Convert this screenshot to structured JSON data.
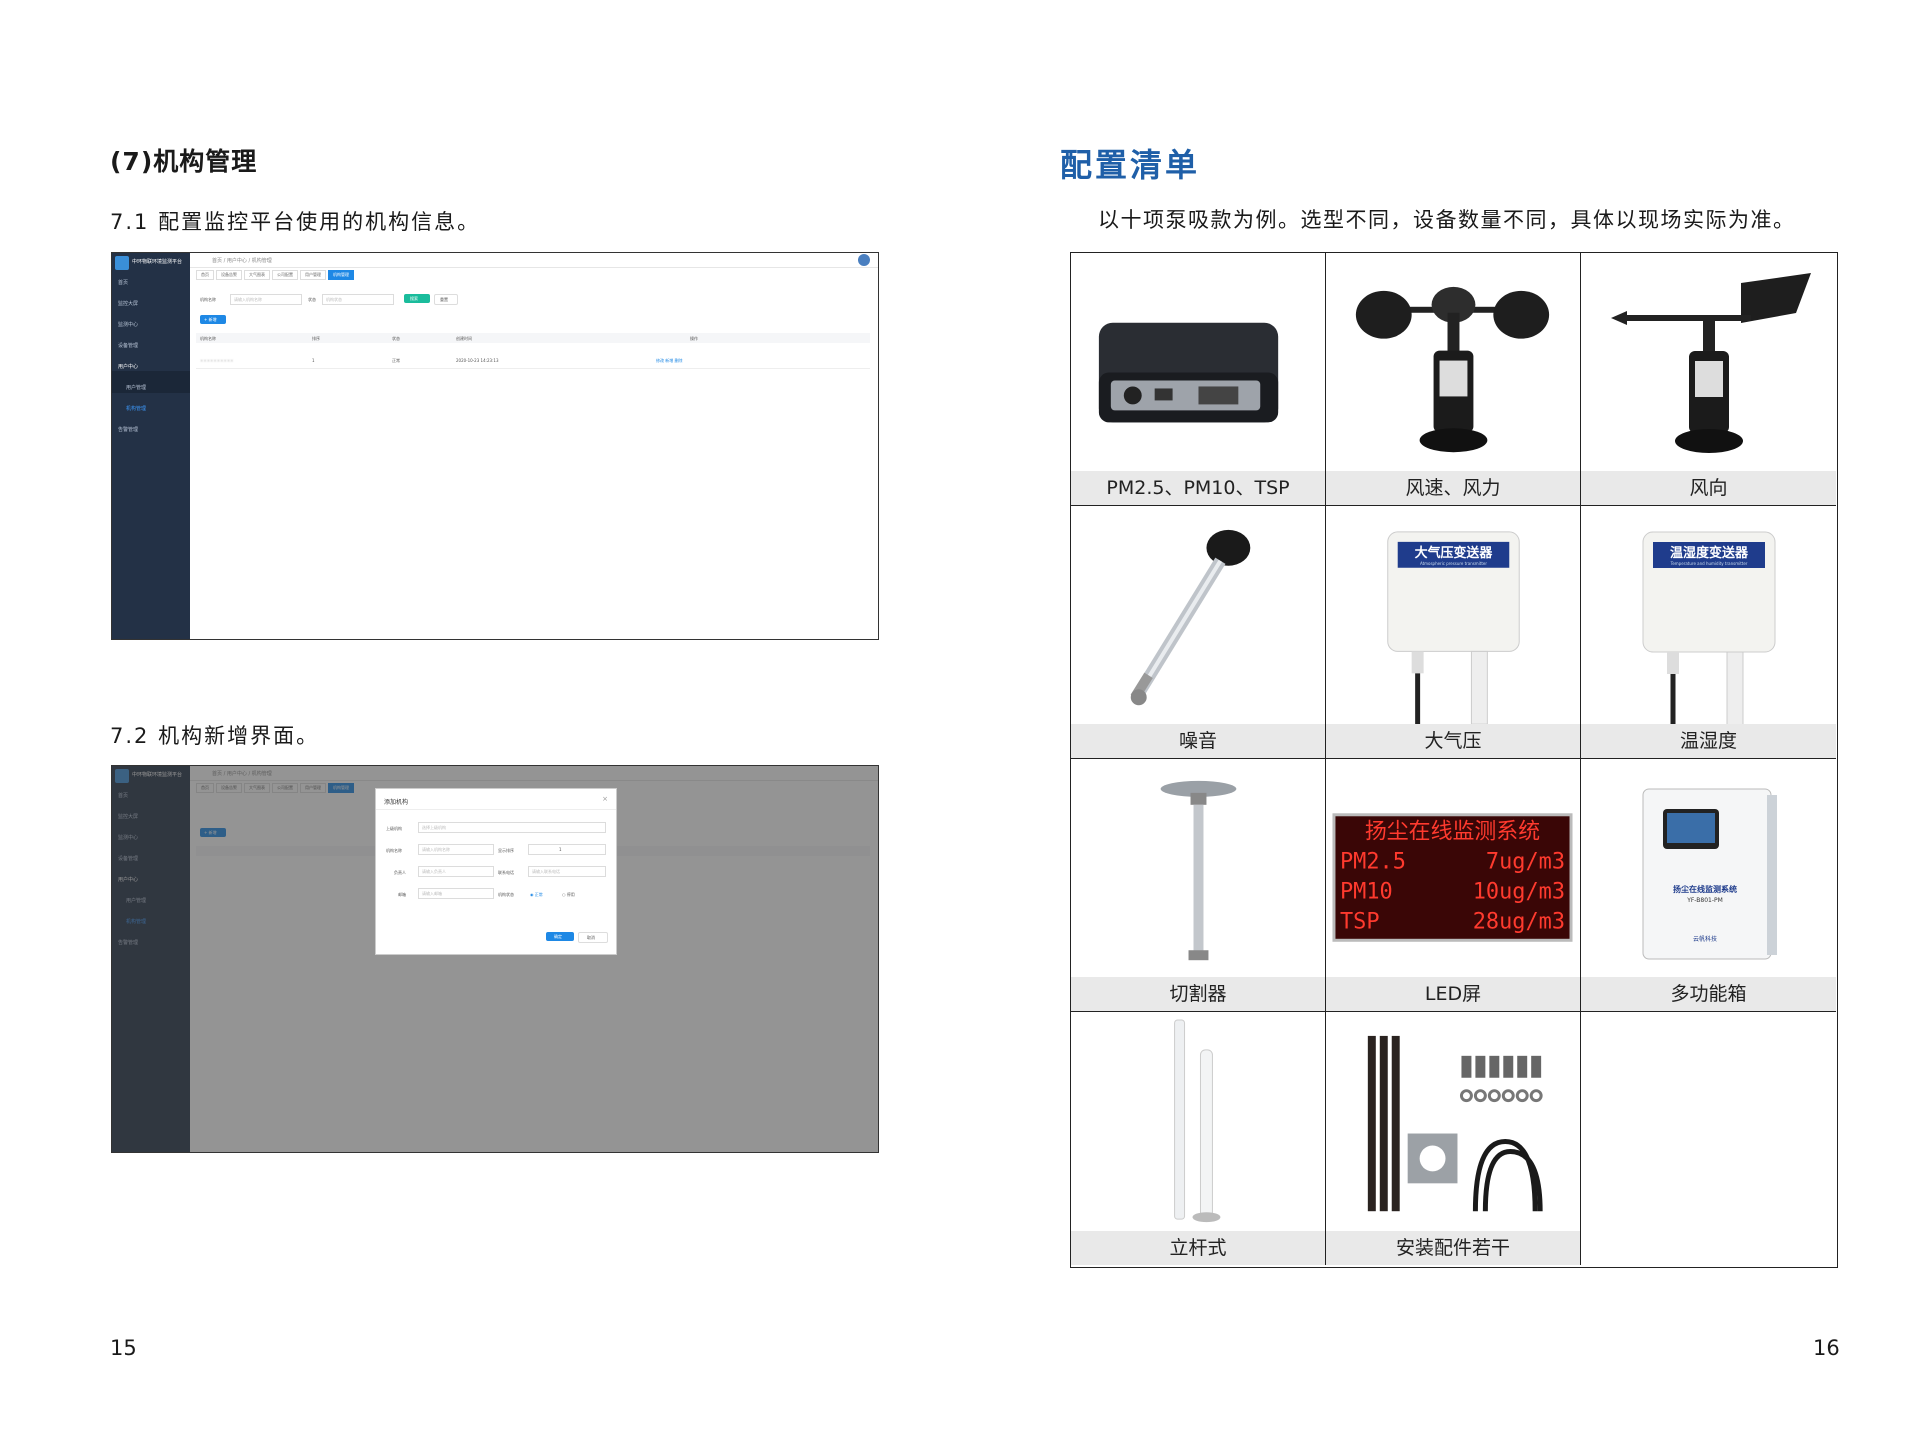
{
  "left_page": {
    "heading": "(7)机构管理",
    "item1": "7.1 配置监控平台使用的机构信息。",
    "item2": "7.2 机构新增界面。",
    "page_number": "15"
  },
  "right_page": {
    "heading": "配置清单",
    "note": "以十项泵吸款为例。选型不同，设备数量不同，具体以现场实际为准。",
    "page_number": "16"
  },
  "screenshot1": {
    "menu": [
      "首页",
      "监控大屏",
      "监测中心",
      "设备管理",
      "用户中心",
      "用户管理",
      "机构管理",
      "告警管理"
    ],
    "breadcrumb": "首页 / 用户中心 / 机构管理",
    "tabs": [
      "首页",
      "设备告警",
      "大气图表",
      "公司配置",
      "用户管理",
      "机构管理"
    ],
    "filter_name_label": "机构名称",
    "filter_name_placeholder": "请输入机构名称",
    "filter_status_label": "状态",
    "filter_status_placeholder": "机构状态",
    "search_btn": "搜索",
    "reset_btn": "重置",
    "add_btn": "+ 新增",
    "columns": [
      "机构名称",
      "排序",
      "状态",
      "创建时间",
      "操作"
    ],
    "rows": [
      [
        "××××××××××",
        "1",
        "正常",
        "2020-10-23 14:23:13",
        "修改  新增  删除"
      ]
    ]
  },
  "screenshot2": {
    "modal_title": "添加机构",
    "fields": [
      "上级机构",
      "机构名称",
      "显示排序",
      "负责人",
      "联系电话",
      "邮箱",
      "机构状态"
    ],
    "placeholders": [
      "选择上级机构",
      "请输入机构名称",
      "1",
      "请输入负责人",
      "请输入联系电话",
      "请输入邮箱"
    ],
    "status_options": [
      "正常",
      "停用"
    ],
    "confirm_btn": "确定",
    "cancel_btn": "取消"
  },
  "products": [
    {
      "label": "PM2.5、PM10、TSP",
      "icon": "sensor-box"
    },
    {
      "label": "风速、风力",
      "icon": "anemometer"
    },
    {
      "label": "风向",
      "icon": "wind-vane"
    },
    {
      "label": "噪音",
      "icon": "noise-sensor"
    },
    {
      "label": "大气压",
      "icon": "pressure-transmitter"
    },
    {
      "label": "温湿度",
      "icon": "temp-humidity-transmitter"
    },
    {
      "label": "切割器",
      "icon": "cutter"
    },
    {
      "label": "LED屏",
      "icon": "led-screen"
    },
    {
      "label": "多功能箱",
      "icon": "cabinet"
    },
    {
      "label": "立杆式",
      "icon": "pole"
    },
    {
      "label": "安装配件若干",
      "icon": "mounting-kit"
    }
  ],
  "led_screen": {
    "title": "扬尘在线监测系统",
    "lines": [
      [
        "PM2.5",
        "7ug/m3"
      ],
      [
        "PM10",
        "10ug/m3"
      ],
      [
        "TSP",
        "28ug/m3"
      ]
    ]
  },
  "transmitters": {
    "pressure_label": "大气压变送器",
    "pressure_sub": "Atmospheric pressure transmitter",
    "th_label": "温湿度变送器",
    "th_sub": "Temperature and humidity transmitter"
  },
  "cabinet": {
    "label": "扬尘在线监测系统",
    "model": "YF-B801-PM",
    "brand": "云帆科技"
  }
}
